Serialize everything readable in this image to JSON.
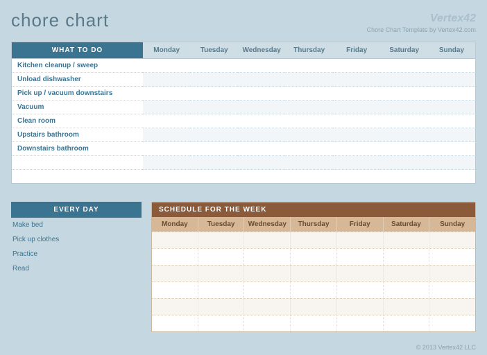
{
  "title": "chore chart",
  "brand": {
    "logo": "Vertex42",
    "sub": "Chore Chart Template by Vertex42.com"
  },
  "what_header": "WHAT TO DO",
  "days": [
    "Monday",
    "Tuesday",
    "Wednesday",
    "Thursday",
    "Friday",
    "Saturday",
    "Sunday"
  ],
  "chores": [
    "Kitchen cleanup / sweep",
    "Unload dishwasher",
    "Pick up / vacuum downstairs",
    "Vacuum",
    "Clean room",
    "Upstairs bathroom",
    "Downstairs bathroom",
    "",
    ""
  ],
  "everyday_header": "EVERY DAY",
  "everyday": [
    "Make bed",
    "Pick up clothes",
    "Practice",
    "Read"
  ],
  "schedule_header": "SCHEDULE FOR THE WEEK",
  "footer": "© 2013 Vertex42 LLC"
}
